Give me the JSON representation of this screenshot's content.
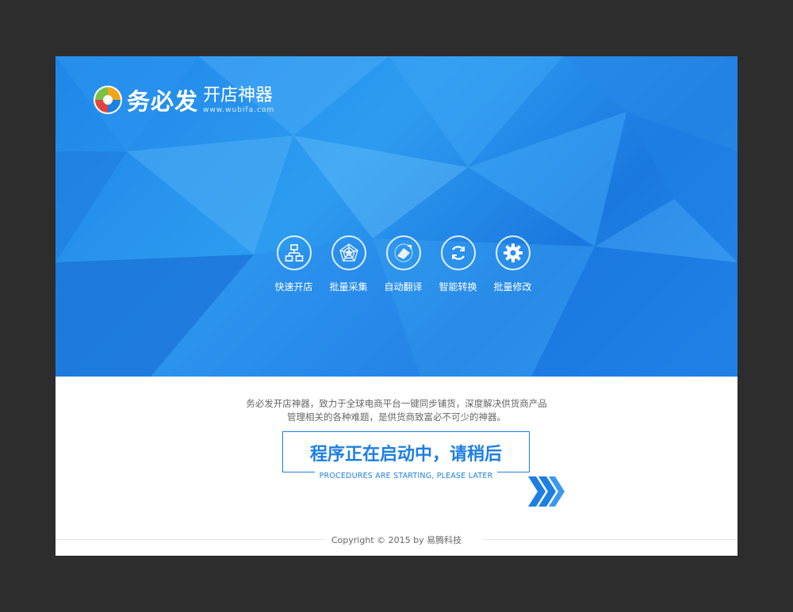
{
  "logo": {
    "brand": "务必发",
    "product": "开店神器",
    "url": "www.wubifa.com"
  },
  "features": [
    {
      "label": "快速开店",
      "icon": "sitemap-icon"
    },
    {
      "label": "批量采集",
      "icon": "radar-web-icon"
    },
    {
      "label": "自动翻译",
      "icon": "translate-icon"
    },
    {
      "label": "智能转换",
      "icon": "refresh-icon"
    },
    {
      "label": "批量修改",
      "icon": "gear-icon"
    }
  ],
  "description": {
    "line1": "务必发开店神器，致力于全球电商平台一键同步铺货，深度解决供货商产品",
    "line2": "管理相关的各种难题，是供货商致富必不可少的神器。"
  },
  "status": {
    "title": "程序正在启动中，请稍后",
    "subtitle": "PROCEDURES ARE STARTING, PLEASE LATER"
  },
  "footer": {
    "copyright": "Copyright © 2015 by 易腾科技"
  },
  "colors": {
    "accent": "#1e7fe2",
    "frame": "#2d2d2d"
  }
}
